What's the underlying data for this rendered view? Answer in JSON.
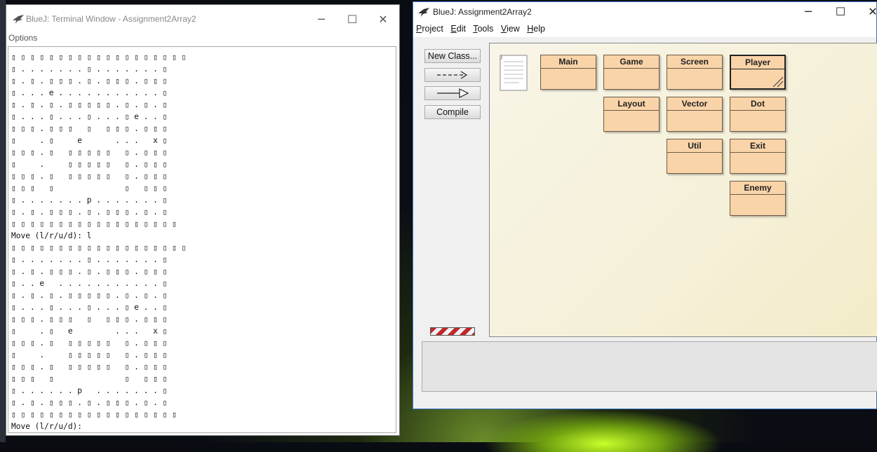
{
  "terminal": {
    "title": "BlueJ: Terminal Window - Assignment2Array2",
    "menu_options": "Options",
    "output": "▯ ▯ ▯ ▯ ▯ ▯ ▯ ▯ ▯ ▯ ▯ ▯ ▯ ▯ ▯ ▯ ▯ ▯ ▯\n▯ . . . . . . . ▯ . . . . . . . ▯\n▯ . ▯ . ▯ ▯ ▯ . ▯ . ▯ ▯ ▯ . ▯ ▯ ▯\n▯ . . . e . . . . . . . . . . . ▯\n▯ . ▯ . ▯ . ▯ ▯ ▯ ▯ ▯ . ▯ . ▯ . ▯\n▯ . . . ▯ . . . ▯ . . . ▯ e . . ▯\n▯ ▯ ▯ . ▯ ▯ ▯   ▯   ▯ ▯ ▯ . ▯ ▯ ▯\n▯     . ▯     e       . . .   x ▯\n▯ ▯ ▯ . ▯   ▯ ▯ ▯ ▯ ▯   ▯ . ▯ ▯ ▯\n▯     .     ▯ ▯ ▯ ▯ ▯   ▯ . ▯ ▯ ▯\n▯ ▯ ▯ . ▯   ▯ ▯ ▯ ▯ ▯   ▯ . ▯ ▯ ▯\n▯ ▯ ▯   ▯               ▯   ▯ ▯ ▯\n▯ . . . . . . . p . . . . . . . ▯\n▯ . ▯ . ▯ ▯ ▯ . ▯ . ▯ ▯ ▯ . ▯ . ▯\n▯ ▯ ▯ ▯ ▯ ▯ ▯ ▯ ▯ ▯ ▯ ▯ ▯ ▯ ▯ ▯ ▯ ▯\nMove (l/r/u/d): l\n▯ ▯ ▯ ▯ ▯ ▯ ▯ ▯ ▯ ▯ ▯ ▯ ▯ ▯ ▯ ▯ ▯ ▯ ▯\n▯ . . . . . . . ▯ . . . . . . . ▯\n▯ . ▯ . ▯ ▯ ▯ . ▯ . ▯ ▯ ▯ . ▯ ▯ ▯\n▯ . . e   . . . . . . . . . . . ▯\n▯ . ▯ . ▯ . ▯ ▯ ▯ ▯ ▯ . ▯ . ▯ . ▯\n▯ . . . ▯ . . . ▯ . . . ▯ e . . ▯\n▯ ▯ ▯ . ▯ ▯ ▯   ▯   ▯ ▯ ▯ . ▯ ▯ ▯\n▯     . ▯   e         . . .   x ▯\n▯ ▯ ▯ . ▯   ▯ ▯ ▯ ▯ ▯   ▯ . ▯ ▯ ▯\n▯     .     ▯ ▯ ▯ ▯ ▯   ▯ . ▯ ▯ ▯\n▯ ▯ ▯ . ▯   ▯ ▯ ▯ ▯ ▯   ▯ . ▯ ▯ ▯\n▯ ▯ ▯   ▯               ▯   ▯ ▯ ▯\n▯ . . . . . . p   . . . . . . . ▯\n▯ . ▯ . ▯ ▯ ▯ . ▯ . ▯ ▯ ▯ . ▯ . ▯\n▯ ▯ ▯ ▯ ▯ ▯ ▯ ▯ ▯ ▯ ▯ ▯ ▯ ▯ ▯ ▯ ▯ ▯\nMove (l/r/u/d):"
  },
  "bluej": {
    "title": "BlueJ:  Assignment2Array2",
    "menu": [
      {
        "label": "Project"
      },
      {
        "label": "Edit"
      },
      {
        "label": "Tools"
      },
      {
        "label": "View"
      },
      {
        "label": "Help"
      }
    ],
    "toolbar": {
      "new_class": "New Class...",
      "uses_arrow": "--->",
      "compile": "Compile"
    },
    "classes": [
      {
        "name": "Main",
        "selected": false
      },
      {
        "name": "Game",
        "selected": false
      },
      {
        "name": "Screen",
        "selected": false
      },
      {
        "name": "Player",
        "selected": true
      },
      {
        "name": "Layout",
        "selected": false
      },
      {
        "name": "Vector",
        "selected": false
      },
      {
        "name": "Dot",
        "selected": false
      },
      {
        "name": "Util",
        "selected": false
      },
      {
        "name": "Exit",
        "selected": false
      },
      {
        "name": "Enemy",
        "selected": false
      }
    ],
    "class_color": "#fad4a9"
  },
  "icons": [
    "bluej-bird-icon",
    "minimize-icon",
    "maximize-icon",
    "close-icon",
    "readme-document-icon",
    "arrow-icon",
    "inheritance-arrow-icon"
  ]
}
